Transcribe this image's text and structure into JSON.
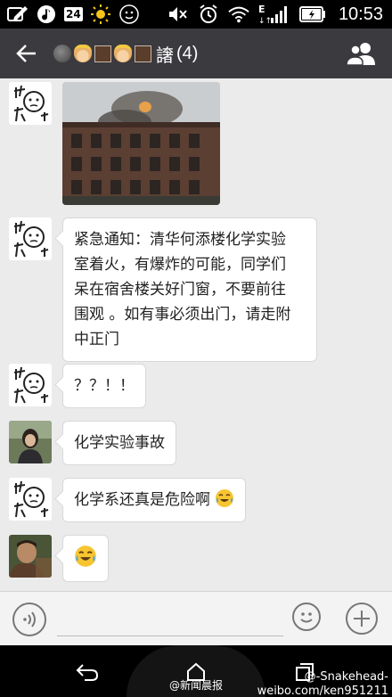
{
  "status_bar": {
    "network_badge": "24",
    "signal_label": "E",
    "time": "10:53",
    "icons": [
      "edit-icon",
      "music-icon",
      "network-badge",
      "sun-icon",
      "face-icon",
      "mute-icon",
      "alarm-icon",
      "wifi-icon",
      "signal-icon",
      "battery-icon"
    ]
  },
  "title_bar": {
    "count": "(4)",
    "title_glyph": "譇",
    "icons": [
      "back-arrow-icon",
      "group-members-icon"
    ]
  },
  "messages": [
    {
      "sender": "cartoon-avatar",
      "type": "image",
      "image": "building-fire-photo"
    },
    {
      "sender": "cartoon-avatar",
      "type": "text",
      "lines": [
        "紧急通知：清华何添楼化学实验",
        "室着火，有爆炸的可能，同学们",
        "呆在宿舍楼关好门窗，不要前往",
        "围观 。如有事必须出门，请走附",
        "中正门"
      ]
    },
    {
      "sender": "cartoon-avatar",
      "type": "text",
      "text": "？？！！"
    },
    {
      "sender": "photo-avatar-woman",
      "type": "text",
      "text": "化学实验事故"
    },
    {
      "sender": "cartoon-avatar",
      "type": "text",
      "text": "化学系还真是危险啊",
      "emoji": "crying-laughing-emoji"
    },
    {
      "sender": "photo-avatar-man",
      "type": "emoji",
      "emoji": "crying-laughing-emoji"
    }
  ],
  "input_bar": {
    "value": "",
    "placeholder": ""
  },
  "watermark": {
    "left": "@新闻晨报",
    "right_line1": "@-Snakehead-",
    "right_line2": "weibo.com/ken951211"
  },
  "colors": {
    "status_bar_bg": "#000000",
    "title_bar_bg": "#3a3a3f",
    "chat_bg": "#ebebeb",
    "bubble_bg": "#ffffff",
    "input_bar_bg": "#f3f3f3"
  }
}
